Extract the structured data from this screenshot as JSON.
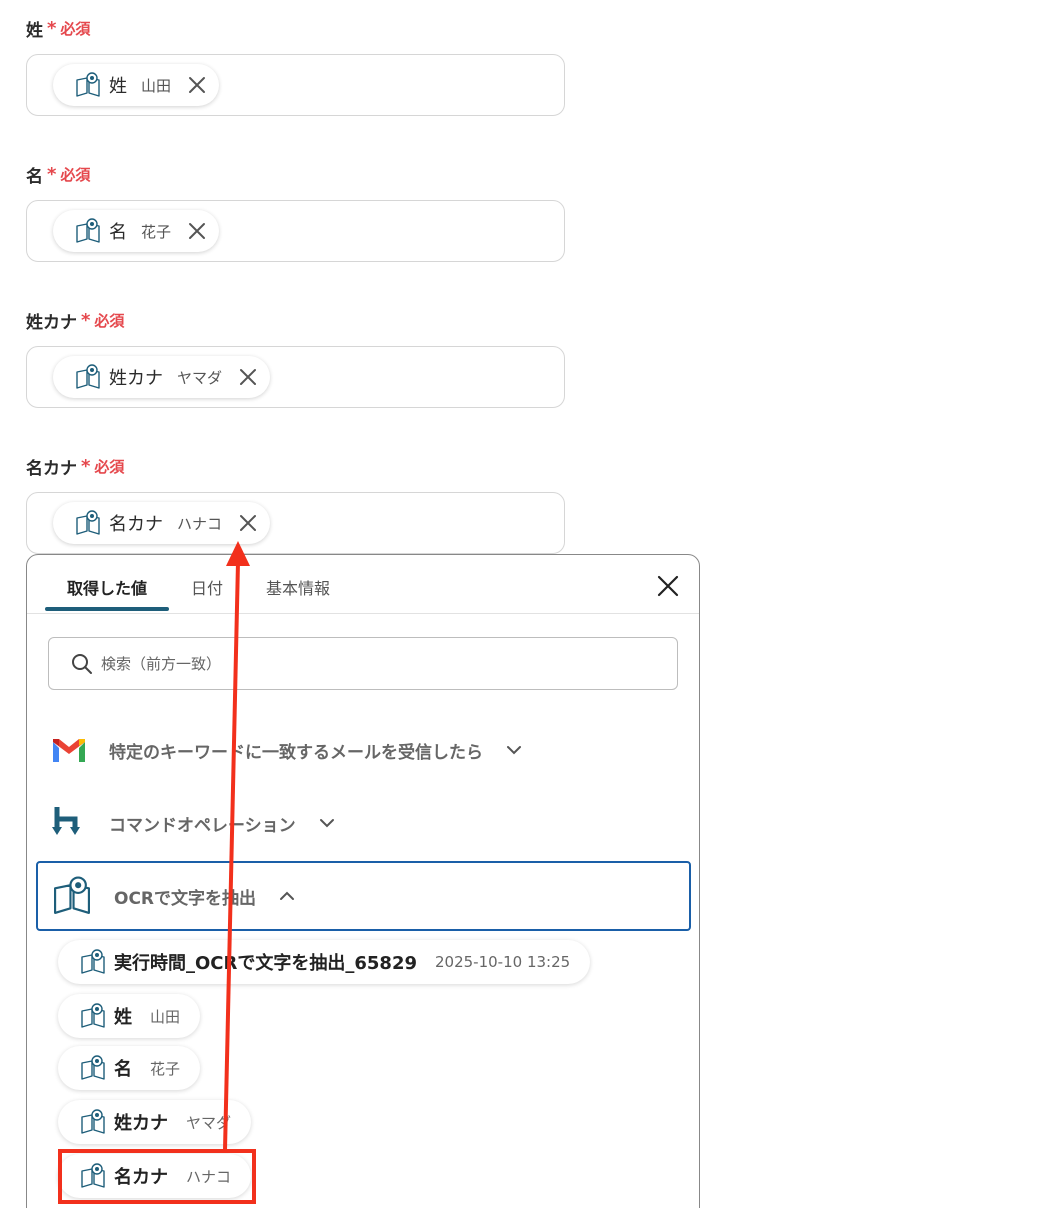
{
  "required_label": "必須",
  "fields": [
    {
      "label": "姓",
      "chip_name": "姓",
      "chip_value": "山田"
    },
    {
      "label": "名",
      "chip_name": "名",
      "chip_value": "花子"
    },
    {
      "label": "姓カナ",
      "chip_name": "姓カナ",
      "chip_value": "ヤマダ"
    },
    {
      "label": "名カナ",
      "chip_name": "名カナ",
      "chip_value": "ハナコ"
    }
  ],
  "popup": {
    "tabs": [
      "取得した値",
      "日付",
      "基本情報"
    ],
    "search_placeholder": "検索（前方一致）",
    "sections": [
      {
        "title": "特定のキーワードに一致するメールを受信したら",
        "icon": "gmail-icon",
        "expanded": false
      },
      {
        "title": "コマンドオペレーション",
        "icon": "command-operation-icon",
        "expanded": false
      },
      {
        "title": "OCRで文字を抽出",
        "icon": "ocr-book-icon",
        "expanded": true
      }
    ],
    "values": [
      {
        "name": "実行時間_OCRで文字を抽出_65829",
        "value": "2025-10-10 13:25"
      },
      {
        "name": "姓",
        "value": "山田"
      },
      {
        "name": "名",
        "value": "花子"
      },
      {
        "name": "姓カナ",
        "value": "ヤマダ"
      },
      {
        "name": "名カナ",
        "value": "ハナコ"
      }
    ]
  },
  "colors": {
    "required": "#e5484d",
    "accent": "#1e5e7a",
    "highlight": "#f2301c",
    "active_border": "#1a5fa8"
  }
}
